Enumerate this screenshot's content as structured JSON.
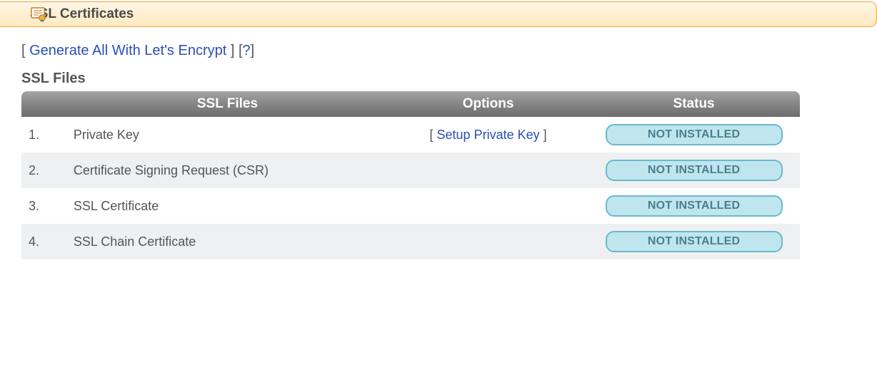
{
  "header": {
    "title": "SSL Certificates"
  },
  "actions": {
    "generate_all_label": "Generate All With Let's Encrypt",
    "help_label": "?"
  },
  "section": {
    "title": "SSL Files"
  },
  "table": {
    "columns": {
      "files": "SSL Files",
      "options": "Options",
      "status": "Status"
    },
    "rows": [
      {
        "num": "1.",
        "name": "Private Key",
        "option_label": "Setup Private Key",
        "status": "NOT INSTALLED"
      },
      {
        "num": "2.",
        "name": "Certificate Signing Request (CSR)",
        "option_label": "",
        "status": "NOT INSTALLED"
      },
      {
        "num": "3.",
        "name": "SSL Certificate",
        "option_label": "",
        "status": "NOT INSTALLED"
      },
      {
        "num": "4.",
        "name": "SSL Chain Certificate",
        "option_label": "",
        "status": "NOT INSTALLED"
      }
    ]
  }
}
